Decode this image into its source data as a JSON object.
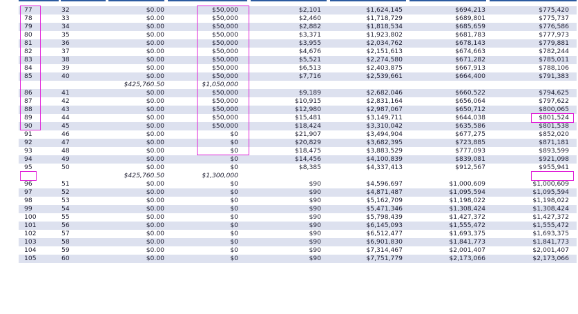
{
  "table": {
    "rows": [
      {
        "type": "data",
        "age": "77",
        "year": "32",
        "c3": "$0.00",
        "c4": "$50,000",
        "c5": "$2,101",
        "c6": "$1,624,145",
        "c7": "$694,213",
        "c8": "$775,420"
      },
      {
        "type": "data",
        "age": "78",
        "year": "33",
        "c3": "$0.00",
        "c4": "$50,000",
        "c5": "$2,460",
        "c6": "$1,718,729",
        "c7": "$689,801",
        "c8": "$775,737"
      },
      {
        "type": "data",
        "age": "79",
        "year": "34",
        "c3": "$0.00",
        "c4": "$50,000",
        "c5": "$2,882",
        "c6": "$1,818,534",
        "c7": "$685,659",
        "c8": "$776,586"
      },
      {
        "type": "data",
        "age": "80",
        "year": "35",
        "c3": "$0.00",
        "c4": "$50,000",
        "c5": "$3,371",
        "c6": "$1,923,802",
        "c7": "$681,783",
        "c8": "$777,973"
      },
      {
        "type": "data",
        "age": "81",
        "year": "36",
        "c3": "$0.00",
        "c4": "$50,000",
        "c5": "$3,955",
        "c6": "$2,034,762",
        "c7": "$678,143",
        "c8": "$779,881"
      },
      {
        "type": "data",
        "age": "82",
        "year": "37",
        "c3": "$0.00",
        "c4": "$50,000",
        "c5": "$4,676",
        "c6": "$2,151,613",
        "c7": "$674,663",
        "c8": "$782,244"
      },
      {
        "type": "data",
        "age": "83",
        "year": "38",
        "c3": "$0.00",
        "c4": "$50,000",
        "c5": "$5,521",
        "c6": "$2,274,580",
        "c7": "$671,282",
        "c8": "$785,011"
      },
      {
        "type": "data",
        "age": "84",
        "year": "39",
        "c3": "$0.00",
        "c4": "$50,000",
        "c5": "$6,513",
        "c6": "$2,403,875",
        "c7": "$667,913",
        "c8": "$788,106"
      },
      {
        "type": "data",
        "age": "85",
        "year": "40",
        "c3": "$0.00",
        "c4": "$50,000",
        "c5": "$7,716",
        "c6": "$2,539,661",
        "c7": "$664,400",
        "c8": "$791,383"
      },
      {
        "type": "subtotal",
        "age": "",
        "year": "",
        "c3": "$425,760.50",
        "c4": "$1,050,000",
        "c5": "",
        "c6": "",
        "c7": "",
        "c8": ""
      },
      {
        "type": "data",
        "age": "86",
        "year": "41",
        "c3": "$0.00",
        "c4": "$50,000",
        "c5": "$9,189",
        "c6": "$2,682,046",
        "c7": "$660,522",
        "c8": "$794,625"
      },
      {
        "type": "data",
        "age": "87",
        "year": "42",
        "c3": "$0.00",
        "c4": "$50,000",
        "c5": "$10,915",
        "c6": "$2,831,164",
        "c7": "$656,064",
        "c8": "$797,622"
      },
      {
        "type": "data",
        "age": "88",
        "year": "43",
        "c3": "$0.00",
        "c4": "$50,000",
        "c5": "$12,980",
        "c6": "$2,987,067",
        "c7": "$650,712",
        "c8": "$800,065"
      },
      {
        "type": "data",
        "age": "89",
        "year": "44",
        "c3": "$0.00",
        "c4": "$50,000",
        "c5": "$15,481",
        "c6": "$3,149,711",
        "c7": "$644,038",
        "c8": "$801,524"
      },
      {
        "type": "data",
        "age": "90",
        "year": "45",
        "c3": "$0.00",
        "c4": "$50,000",
        "c5": "$18,424",
        "c6": "$3,310,042",
        "c7": "$635,586",
        "c8": "$801,538"
      },
      {
        "type": "data",
        "age": "91",
        "year": "46",
        "c3": "$0.00",
        "c4": "$0",
        "c5": "$21,907",
        "c6": "$3,494,904",
        "c7": "$677,275",
        "c8": "$852,020"
      },
      {
        "type": "data",
        "age": "92",
        "year": "47",
        "c3": "$0.00",
        "c4": "$0",
        "c5": "$20,829",
        "c6": "$3,682,395",
        "c7": "$723,885",
        "c8": "$871,181"
      },
      {
        "type": "data",
        "age": "93",
        "year": "48",
        "c3": "$0.00",
        "c4": "$0",
        "c5": "$18,475",
        "c6": "$3,883,529",
        "c7": "$777,093",
        "c8": "$893,599"
      },
      {
        "type": "data",
        "age": "94",
        "year": "49",
        "c3": "$0.00",
        "c4": "$0",
        "c5": "$14,456",
        "c6": "$4,100,839",
        "c7": "$839,081",
        "c8": "$921,098"
      },
      {
        "type": "data",
        "age": "95",
        "year": "50",
        "c3": "$0.00",
        "c4": "$0",
        "c5": "$8,385",
        "c6": "$4,337,413",
        "c7": "$912,567",
        "c8": "$955,941"
      },
      {
        "type": "subtotal",
        "age": "",
        "year": "",
        "c3": "$425,760.50",
        "c4": "$1,300,000",
        "c5": "",
        "c6": "",
        "c7": "",
        "c8": ""
      },
      {
        "type": "data",
        "age": "96",
        "year": "51",
        "c3": "$0.00",
        "c4": "$0",
        "c5": "$90",
        "c6": "$4,596,697",
        "c7": "$1,000,609",
        "c8": "$1,000,609"
      },
      {
        "type": "data",
        "age": "97",
        "year": "52",
        "c3": "$0.00",
        "c4": "$0",
        "c5": "$90",
        "c6": "$4,871,487",
        "c7": "$1,095,594",
        "c8": "$1,095,594"
      },
      {
        "type": "data",
        "age": "98",
        "year": "53",
        "c3": "$0.00",
        "c4": "$0",
        "c5": "$90",
        "c6": "$5,162,709",
        "c7": "$1,198,022",
        "c8": "$1,198,022"
      },
      {
        "type": "data",
        "age": "99",
        "year": "54",
        "c3": "$0.00",
        "c4": "$0",
        "c5": "$90",
        "c6": "$5,471,346",
        "c7": "$1,308,424",
        "c8": "$1,308,424"
      },
      {
        "type": "data",
        "age": "100",
        "year": "55",
        "c3": "$0.00",
        "c4": "$0",
        "c5": "$90",
        "c6": "$5,798,439",
        "c7": "$1,427,372",
        "c8": "$1,427,372"
      },
      {
        "type": "data",
        "age": "101",
        "year": "56",
        "c3": "$0.00",
        "c4": "$0",
        "c5": "$90",
        "c6": "$6,145,093",
        "c7": "$1,555,472",
        "c8": "$1,555,472"
      },
      {
        "type": "data",
        "age": "102",
        "year": "57",
        "c3": "$0.00",
        "c4": "$0",
        "c5": "$90",
        "c6": "$6,512,477",
        "c7": "$1,693,375",
        "c8": "$1,693,375"
      },
      {
        "type": "data",
        "age": "103",
        "year": "58",
        "c3": "$0.00",
        "c4": "$0",
        "c5": "$90",
        "c6": "$6,901,830",
        "c7": "$1,841,773",
        "c8": "$1,841,773"
      },
      {
        "type": "data",
        "age": "104",
        "year": "59",
        "c3": "$0.00",
        "c4": "$0",
        "c5": "$90",
        "c6": "$7,314,467",
        "c7": "$2,001,407",
        "c8": "$2,001,407"
      },
      {
        "type": "data",
        "age": "105",
        "year": "60",
        "c3": "$0.00",
        "c4": "$0",
        "c5": "$90",
        "c6": "$7,751,779",
        "c7": "$2,173,066",
        "c8": "$2,173,066"
      }
    ]
  },
  "colors": {
    "row_shade": "#dde1ef",
    "highlight_box": "#e020d8",
    "header_rule": "#2b5aa0",
    "text": "#1a1a2e"
  }
}
